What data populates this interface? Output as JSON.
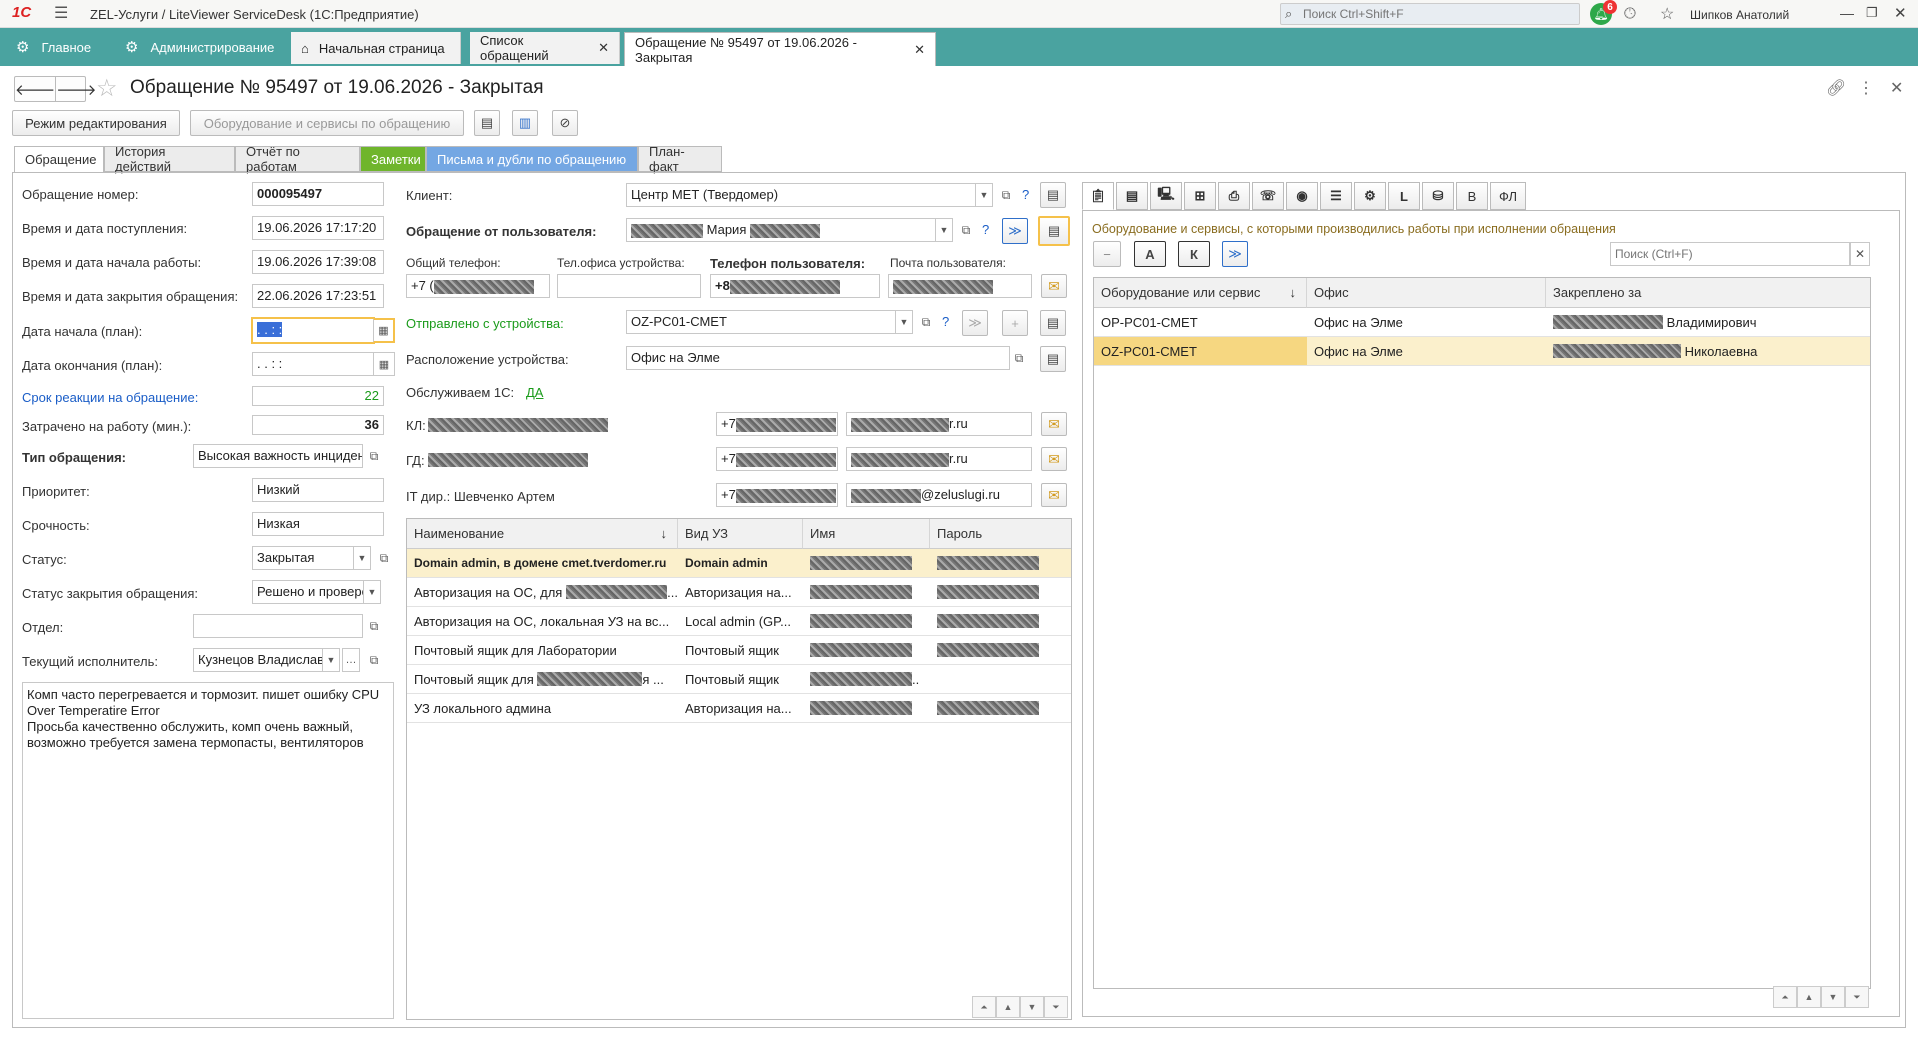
{
  "app": {
    "title": "ZEL-Услуги / LiteViewer ServiceDesk  (1С:Предприятие)",
    "logo": "1С",
    "search_placeholder": "Поиск Ctrl+Shift+F",
    "notifications": "6",
    "user": "Шипков Анатолий"
  },
  "sections": [
    {
      "label": "Главное",
      "icon": "gear-icon"
    },
    {
      "label": "Администрирование",
      "icon": "gear-icon"
    }
  ],
  "open_tabs": [
    "Начальная страница",
    "Список обращений",
    "Обращение № 95497 от 19.06.2026 - Закрытая"
  ],
  "form": {
    "title": "Обращение № 95497 от 19.06.2026 - Закрытая",
    "edit_mode_btn": "Режим редактирования",
    "equipment_btn": "Оборудование и сервисы по обращению",
    "tabs": [
      "Обращение",
      "История действий",
      "Отчёт по работам",
      "Заметки",
      "Письма и дубли по обращению",
      "План-факт"
    ]
  },
  "fields": {
    "number_label": "Обращение номер:",
    "number": "000095497",
    "received_label": "Время и дата поступления:",
    "received": "19.06.2026 17:17:20",
    "start_label": "Время и дата начала работы:",
    "start": "19.06.2026 17:39:08",
    "closed_label": "Время и дата закрытия обращения:",
    "closed": "22.06.2026 17:23:51",
    "plan_start_label": "Дата начала (план):",
    "plan_start": " .  .     :  :",
    "plan_end_label": "Дата окончания (план):",
    "plan_end": " .  .     :  :",
    "reaction_label": "Срок реакции на обращение:",
    "reaction": "22",
    "spent_label": "Затрачено на работу (мин.):",
    "spent": "36",
    "type_label": "Тип обращения:",
    "type": "Высокая важность инцидента",
    "priority_label": "Приоритет:",
    "priority": "Низкий",
    "urgency_label": "Срочность:",
    "urgency": "Низкая",
    "status_label": "Статус:",
    "status": "Закрытая",
    "close_status_label": "Статус закрытия обращения:",
    "close_status": "Решено и проверено",
    "dept_label": "Отдел:",
    "dept": "",
    "executor_label": "Текущий исполнитель:",
    "executor": "Кузнецов Владислав",
    "comment": "Комп часто перегревается и тормозит. пишет ошибку CPU Over Temperatire Error\nПросьба качественно обслужить, комп очень важный, возможно требуется замена термопасты, вентиляторов"
  },
  "client": {
    "client_label": "Клиент:",
    "client": "Центр МЕТ (Твердомер)",
    "user_label": "Обращение от пользователя:",
    "user_name": "Мария",
    "phone_common_label": "Общий телефон:",
    "phone_common": "+7 (",
    "office_phone_label": "Тел.офиса устройства:",
    "user_phone_label": "Телефон пользователя:",
    "user_phone": "+8",
    "email_label": "Почта пользователя:",
    "device_label": "Отправлено с устройства:",
    "device": "OZ-PC01-СМЕТ",
    "location_label": "Расположение устройства:",
    "location": "Офис на Элме",
    "serve1c_label": "Обслуживаем 1С:",
    "serve1c": "ДА",
    "kl_label": "КЛ:",
    "kl_phone": "+7",
    "kl_email": "r.ru",
    "gd_label": "ГД:",
    "gd_phone": "+7",
    "gd_email": "r.ru",
    "it_label": "IT дир.: Шевченко Артем",
    "it_phone": "+7",
    "it_email": "@zeluslugi.ru"
  },
  "accounts_table": {
    "columns": [
      "Наименование",
      "Вид УЗ",
      "Имя",
      "Пароль"
    ],
    "rows": [
      {
        "name": "Domain admin, в домене cmet.tverdomer.ru",
        "type": "Domain admin"
      },
      {
        "name": "Авторизация на ОС, для",
        "type": "Авторизация на..."
      },
      {
        "name": "Авторизация на ОС, локальная УЗ на вс...",
        "type": "Local admin (GP..."
      },
      {
        "name": "Почтовый ящик для Лаборатории",
        "type": "Почтовый ящик"
      },
      {
        "name": "Почтовый ящик для",
        "type": "Почтовый ящик"
      },
      {
        "name": "УЗ локального админа",
        "type": "Авторизация на..."
      }
    ]
  },
  "equipment": {
    "caption": "Оборудование и сервисы, с которыми производились работы при исполнении обращения",
    "btn_a": "А",
    "btn_k": "К",
    "search_placeholder": "Поиск (Ctrl+F)",
    "toolbar_letters": [
      "L",
      "В",
      "ФЛ"
    ],
    "columns": [
      "Оборудование или сервис",
      "Офис",
      "Закреплено за"
    ],
    "rows": [
      {
        "device": "OP-PC01-СМЕТ",
        "office": "Офис на Элме",
        "owner": "Владимирович"
      },
      {
        "device": "OZ-PC01-СМЕТ",
        "office": "Офис на Элме",
        "owner": "Николаевна"
      }
    ]
  },
  "colors": {
    "section_bar": "#4aa3a0",
    "notes_tab": "#6fb52c",
    "letters_tab": "#74a7e3",
    "highlight_row": "#fbf0cc"
  }
}
